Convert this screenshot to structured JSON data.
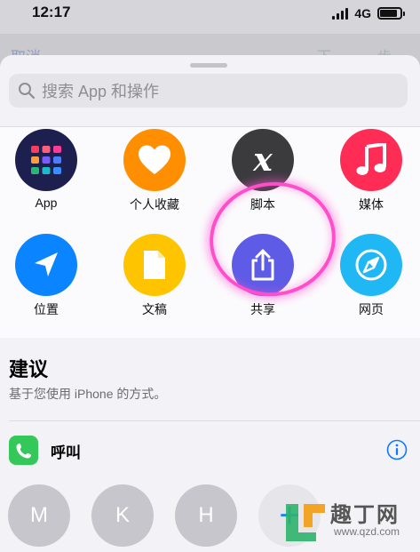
{
  "status_bar": {
    "time": "12:17",
    "network": "4G",
    "battery_level": 0.85
  },
  "background": {
    "cancel_label": "取消",
    "right_label": "下一步"
  },
  "sheet": {
    "search_placeholder": "搜索 App 和操作"
  },
  "apps": [
    {
      "label": "App",
      "icon": "app-grid-icon",
      "color": "#1d1f4e"
    },
    {
      "label": "个人收藏",
      "icon": "heart-icon",
      "color": "#ff8f00"
    },
    {
      "label": "脚本",
      "icon": "script-x-icon",
      "color": "#3b3b3e"
    },
    {
      "label": "媒体",
      "icon": "music-note-icon",
      "color": "#ff2d55"
    },
    {
      "label": "位置",
      "icon": "location-arrow-icon",
      "color": "#0a84ff"
    },
    {
      "label": "文稿",
      "icon": "document-icon",
      "color": "#ffc400"
    },
    {
      "label": "共享",
      "icon": "share-icon",
      "color": "#5e5ce6"
    },
    {
      "label": "网页",
      "icon": "compass-icon",
      "color": "#1fb8f5"
    }
  ],
  "suggestions": {
    "title": "建议",
    "subtitle": "基于您使用 iPhone 的方式。",
    "call_label": "呼叫",
    "contacts": [
      "M",
      "K",
      "H"
    ],
    "add_label": "+"
  },
  "watermark": {
    "text": "趣丁网",
    "url": "www.qzd.com"
  },
  "colors": {
    "accent": "#0a7aff",
    "highlight_ring": "#ff4ec9",
    "phone_green": "#34c759"
  }
}
